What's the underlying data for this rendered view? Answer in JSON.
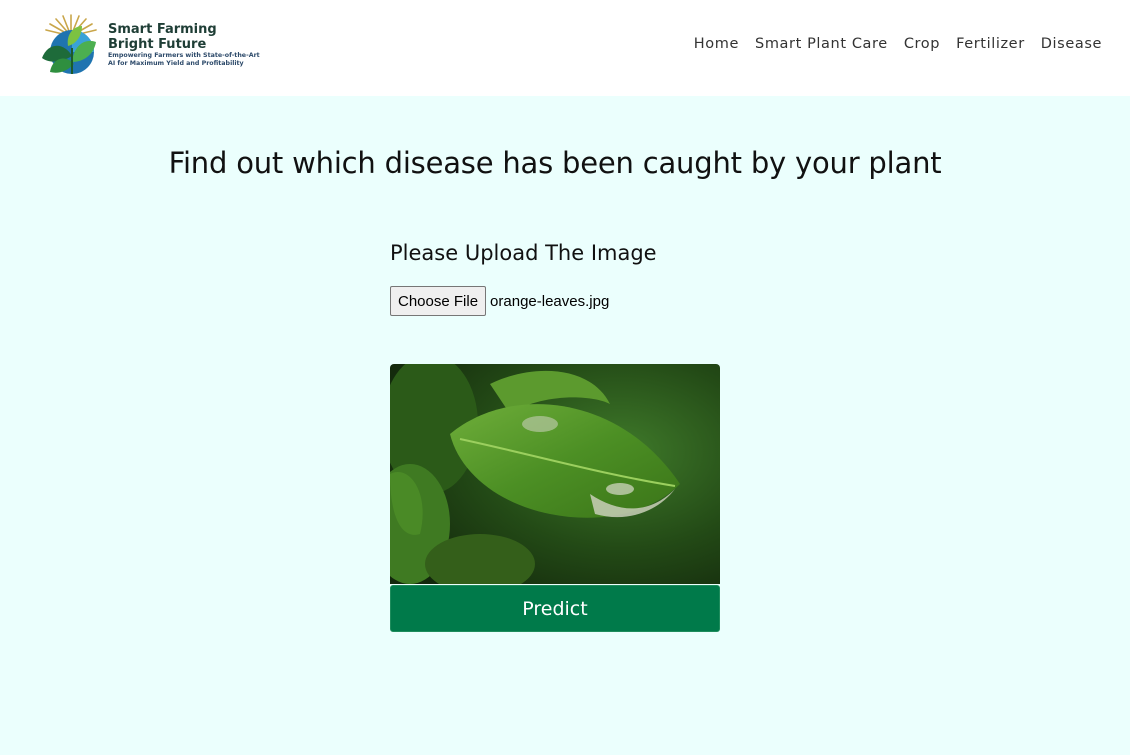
{
  "brand": {
    "line1": "Smart Farming",
    "line2": "Bright Future",
    "tagline": "Empowering Farmers with State-of-the-Art AI for Maximum Yield and Profitability"
  },
  "nav": {
    "items": [
      "Home",
      "Smart Plant Care",
      "Crop",
      "Fertilizer",
      "Disease"
    ]
  },
  "main": {
    "title": "Find out which disease has been caught by your plant",
    "upload_label": "Please Upload The Image",
    "choose_file_label": "Choose File",
    "file_name": "orange-leaves.jpg",
    "predict_label": "Predict"
  },
  "colors": {
    "page_bg": "#ebfffd",
    "nav_bg": "#ffffff",
    "predict_bg": "#007a4a"
  }
}
